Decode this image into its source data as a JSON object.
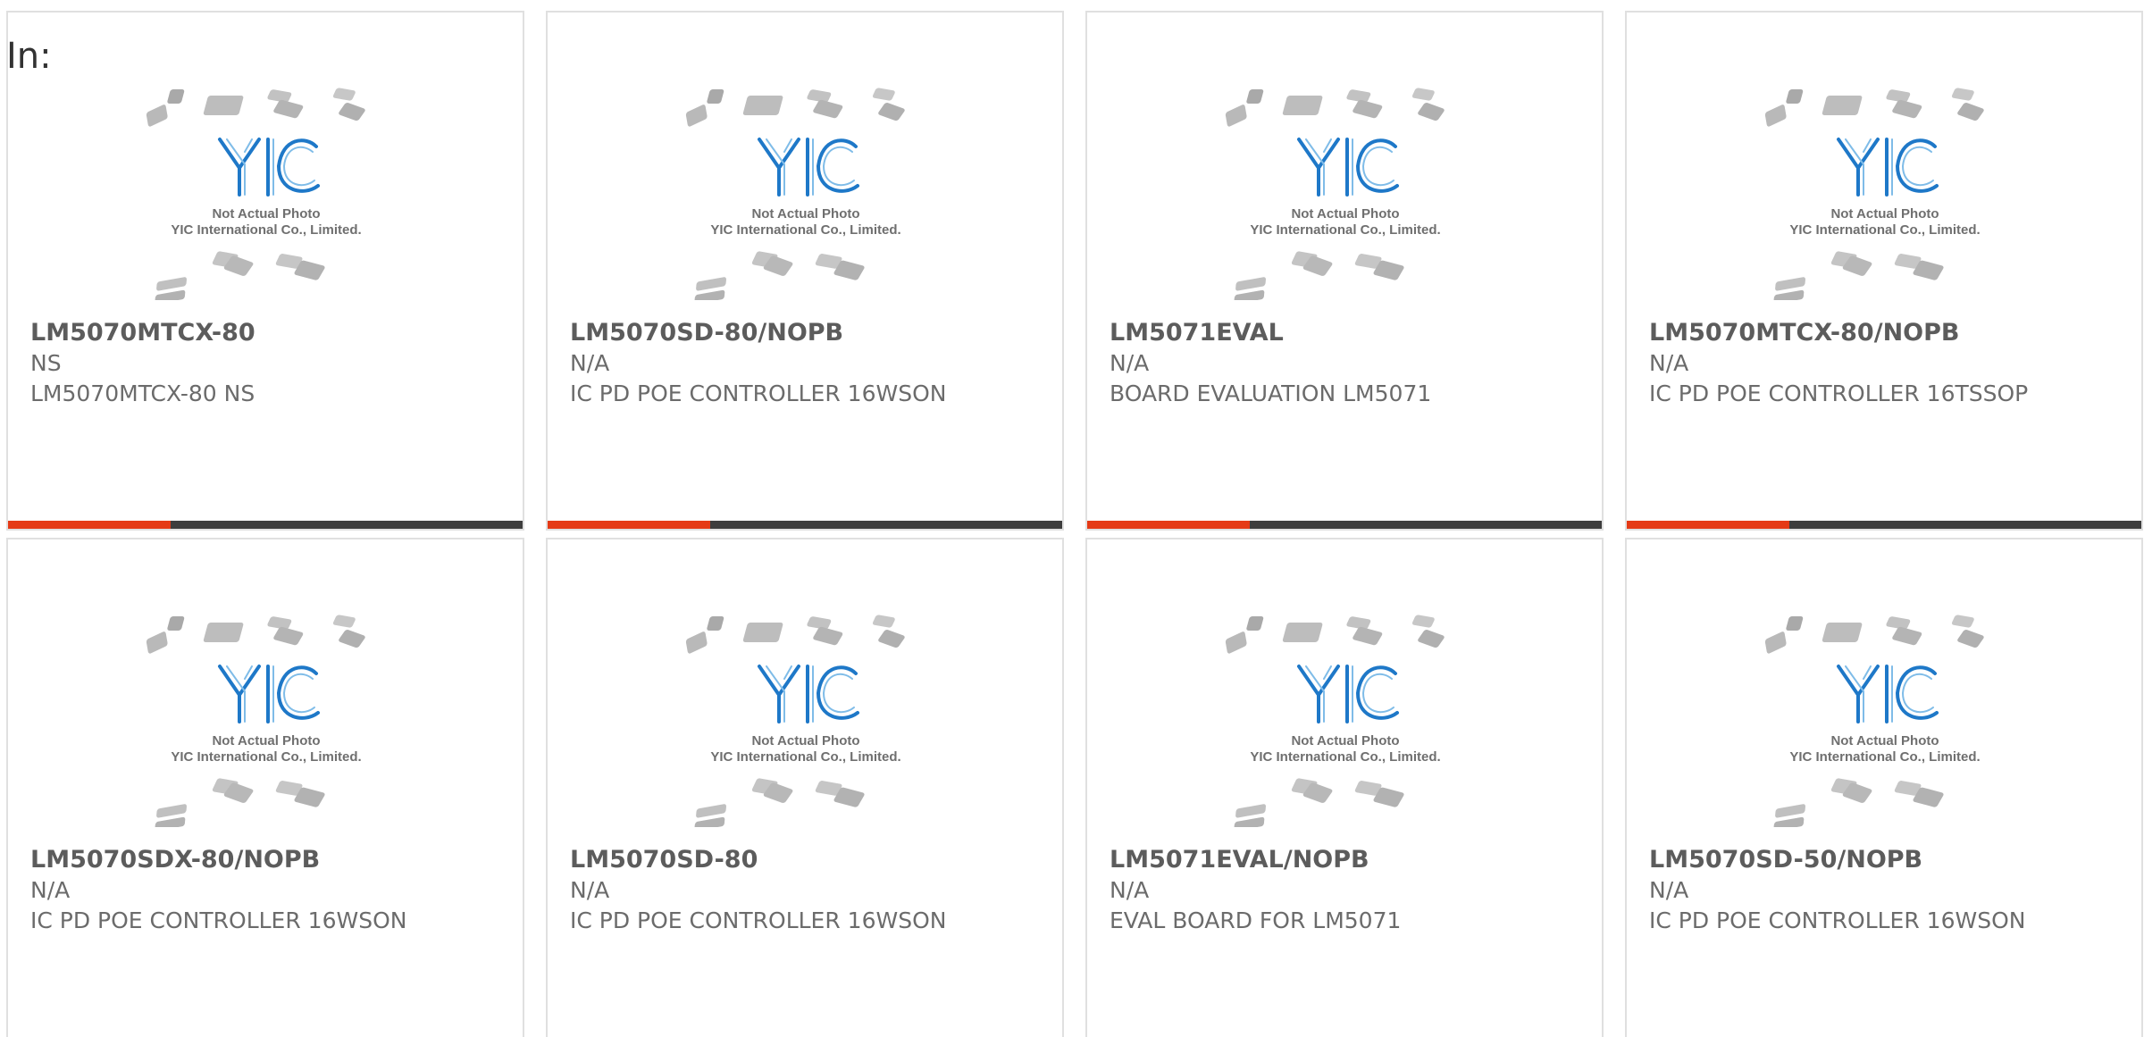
{
  "label": "In:",
  "placeholder_image": {
    "line1": "Not Actual Photo",
    "line2": "YIC International Co., Limited.",
    "logo": "YIC"
  },
  "colors": {
    "accent": "#e53a16",
    "bar": "#3d3d3d",
    "logo_blue": "#1e78c8"
  },
  "products": [
    {
      "part": "LM5070MTCX-80",
      "manufacturer": "NS",
      "description": "LM5070MTCX-80 NS"
    },
    {
      "part": "LM5070SD-80/NOPB",
      "manufacturer": "N/A",
      "description": "IC PD POE CONTROLLER 16WSON"
    },
    {
      "part": "LM5071EVAL",
      "manufacturer": "N/A",
      "description": "BOARD EVALUATION LM5071"
    },
    {
      "part": "LM5070MTCX-80/NOPB",
      "manufacturer": "N/A",
      "description": "IC PD POE CONTROLLER 16TSSOP"
    },
    {
      "part": "LM5070SDX-80/NOPB",
      "manufacturer": "N/A",
      "description": "IC PD POE CONTROLLER 16WSON"
    },
    {
      "part": "LM5070SD-80",
      "manufacturer": "N/A",
      "description": "IC PD POE CONTROLLER 16WSON"
    },
    {
      "part": "LM5071EVAL/NOPB",
      "manufacturer": "N/A",
      "description": "EVAL BOARD FOR LM5071"
    },
    {
      "part": "LM5070SD-50/NOPB",
      "manufacturer": "N/A",
      "description": "IC PD POE CONTROLLER 16WSON"
    }
  ]
}
